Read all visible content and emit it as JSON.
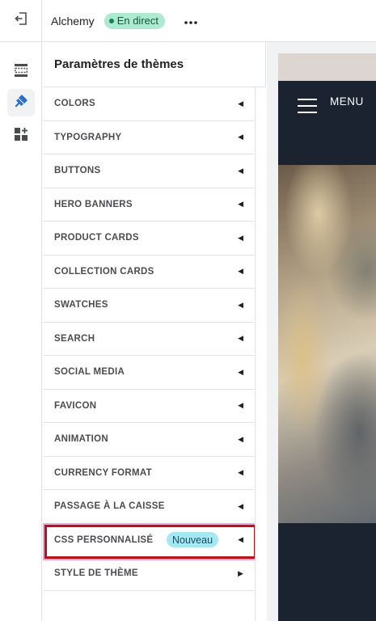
{
  "topbar": {
    "theme_name": "Alchemy",
    "status_badge": "En direct",
    "exit_icon": "exit-icon",
    "more_icon": "more-horizontal-icon"
  },
  "rail": {
    "items": [
      {
        "icon": "sections-icon",
        "active": false
      },
      {
        "icon": "theme-settings-brush-icon",
        "active": true
      },
      {
        "icon": "app-blocks-icon",
        "active": false
      }
    ]
  },
  "panel": {
    "title": "Paramètres de thèmes",
    "items": [
      {
        "label": "COLORS"
      },
      {
        "label": "TYPOGRAPHY"
      },
      {
        "label": "BUTTONS"
      },
      {
        "label": "HERO BANNERS"
      },
      {
        "label": "PRODUCT CARDS"
      },
      {
        "label": "COLLECTION CARDS"
      },
      {
        "label": "SWATCHES"
      },
      {
        "label": "SEARCH"
      },
      {
        "label": "SOCIAL MEDIA"
      },
      {
        "label": "FAVICON"
      },
      {
        "label": "ANIMATION"
      },
      {
        "label": "CURRENCY FORMAT"
      },
      {
        "label": "PASSAGE À LA CAISSE"
      },
      {
        "label": "CSS PERSONNALISÉ",
        "badge": "Nouveau"
      },
      {
        "label": "STYLE DE THÈME"
      }
    ]
  },
  "preview": {
    "menu_label": "MENU"
  },
  "colors": {
    "live_badge_bg": "#aee9d1",
    "new_badge_bg": "#a4e8f2",
    "highlight_border": "#b4141a",
    "preview_header_bg": "#1b2330"
  }
}
